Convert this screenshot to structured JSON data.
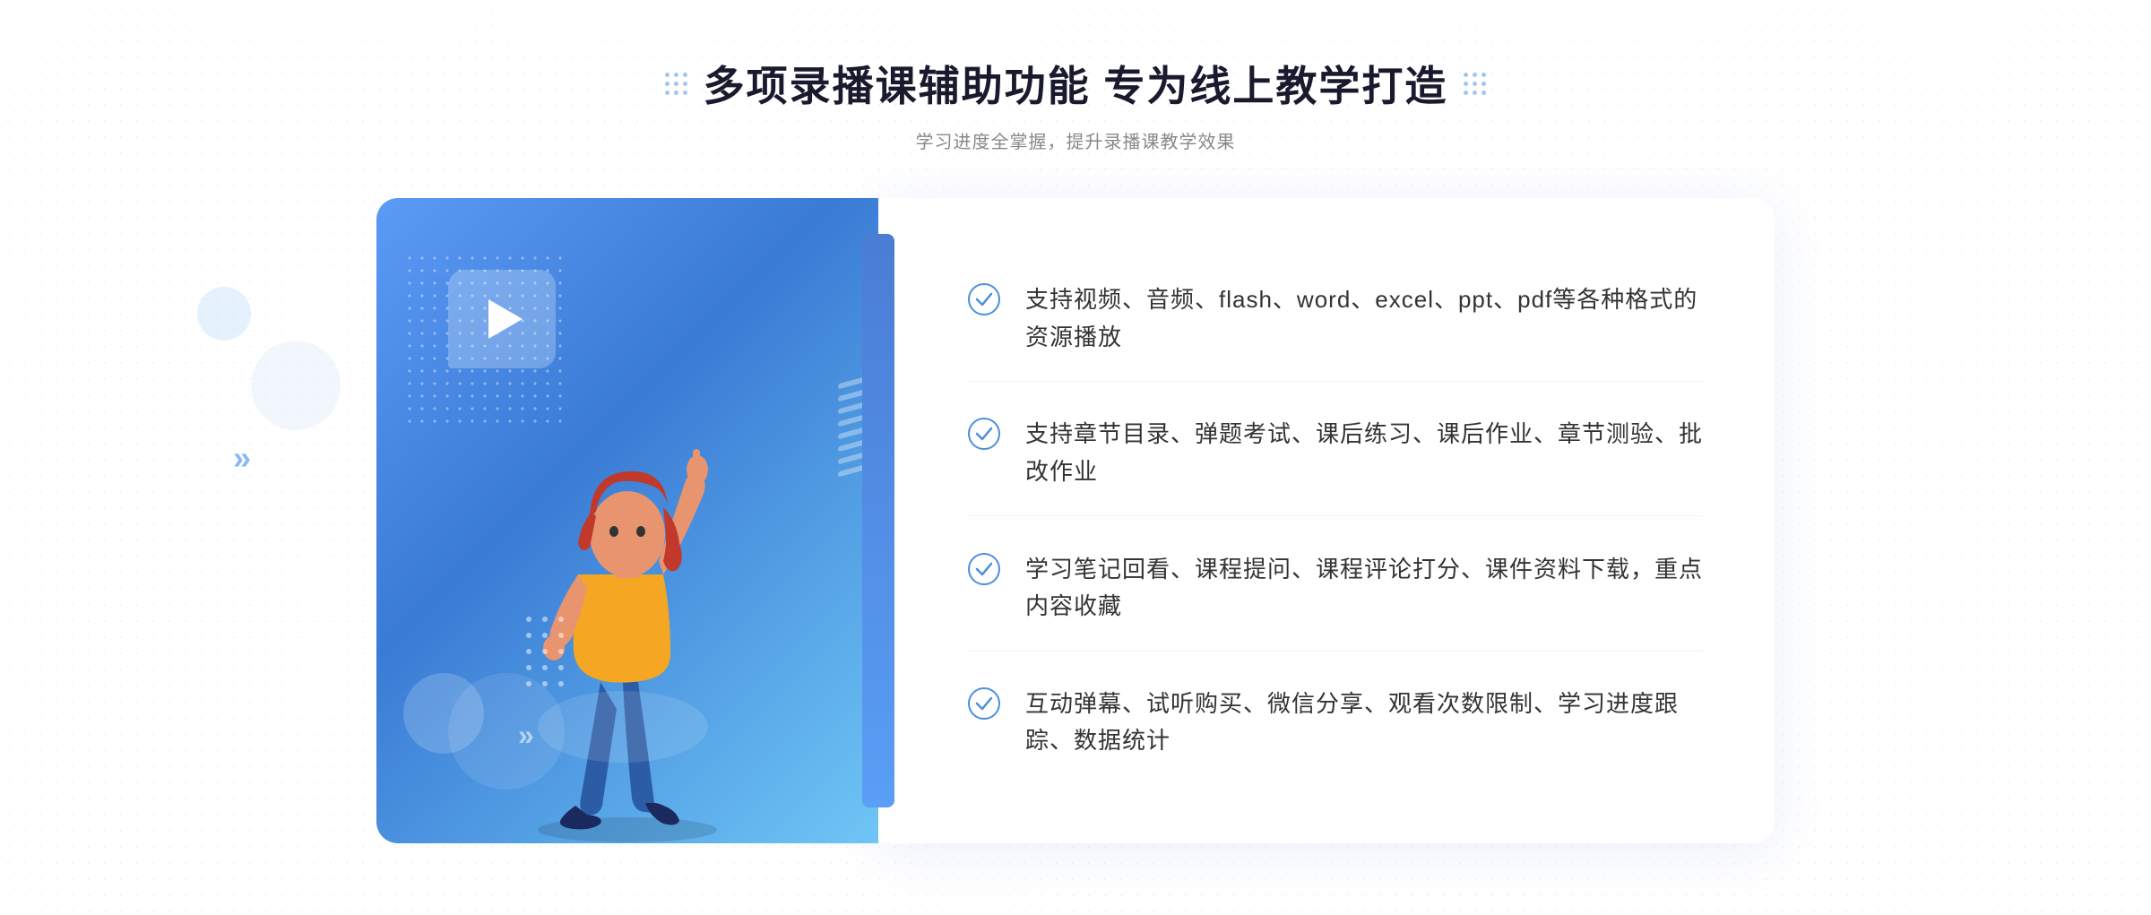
{
  "header": {
    "title": "多项录播课辅助功能 专为线上教学打造",
    "subtitle": "学习进度全掌握，提升录播课教学效果"
  },
  "features": [
    {
      "id": 1,
      "text": "支持视频、音频、flash、word、excel、ppt、pdf等各种格式的资源播放"
    },
    {
      "id": 2,
      "text": "支持章节目录、弹题考试、课后练习、课后作业、章节测验、批改作业"
    },
    {
      "id": 3,
      "text": "学习笔记回看、课程提问、课程评论打分、课件资料下载，重点内容收藏"
    },
    {
      "id": 4,
      "text": "互动弹幕、试听购买、微信分享、观看次数限制、学习进度跟踪、数据统计"
    }
  ],
  "icons": {
    "check_color": "#4a90d9",
    "chevron_color": "#5b9af5"
  }
}
